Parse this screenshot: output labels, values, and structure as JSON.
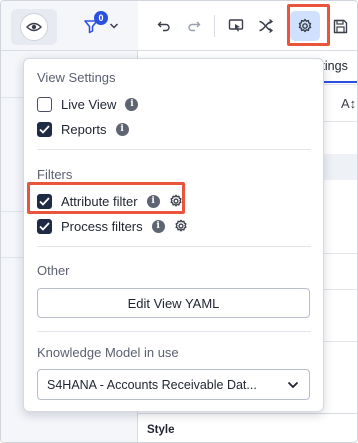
{
  "left_toolbar": {
    "view_icon": "eye-icon",
    "filter_icon": "filter-icon",
    "filter_count": "0"
  },
  "top_toolbar": {
    "icons": [
      "undo-icon",
      "redo-icon",
      "present-icon",
      "shuffle-icon",
      "gear-icon",
      "save-icon"
    ]
  },
  "background": {
    "tab_fragment": "ettings",
    "az_fragment": "A↕",
    "row_fragment": "s",
    "style_label": "Style"
  },
  "menu": {
    "view_settings": {
      "title": "View Settings",
      "items": [
        {
          "label": "Live View",
          "checked": false
        },
        {
          "label": "Reports",
          "checked": true
        }
      ]
    },
    "filters": {
      "title": "Filters",
      "items": [
        {
          "label": "Attribute filter",
          "checked": true
        },
        {
          "label": "Process filters",
          "checked": true
        }
      ]
    },
    "other": {
      "title": "Other",
      "edit_yaml_label": "Edit View YAML"
    },
    "knowledge_model": {
      "title": "Knowledge Model in use",
      "selected": "S4HANA - Accounts Receivable Dat..."
    }
  },
  "colors": {
    "accent": "#2b50e0",
    "highlight": "#e8543c",
    "checkbox": "#1f2a44",
    "active_button": "#cfe1ff"
  }
}
